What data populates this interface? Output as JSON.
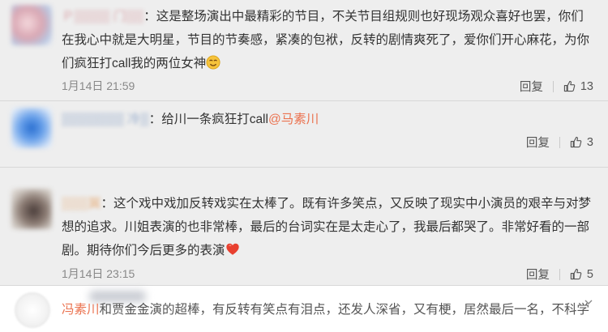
{
  "comments": [
    {
      "username": "Ｐ▒▒▒▒ 门▒▒",
      "separator": "：",
      "text": "这是整场演出中最精彩的节目，不关节目组规则也好现场观众喜好也罢，你们在我心中就是大明星，节目的节奏感，紧凑的包袱，反转的剧情爽死了，爱你们开心麻花，为你们疯狂打call我的两位女神",
      "emoji": "emoji-face-icon",
      "date": "1月14日 21:59",
      "reply_label": "回复",
      "likes": "13"
    },
    {
      "username": "▒▒▒▒▒▒▒ 冷▒",
      "separator": "：",
      "text": "给川一条疯狂打call",
      "mention": "@马素川",
      "reply_label": "回复",
      "likes": "3"
    },
    {
      "username": "▒▒▒翼",
      "separator": "：",
      "text": "这个戏中戏加反转戏实在太棒了。既有许多笑点，又反映了现实中小演员的艰辛与对梦想的追求。川姐表演的也非常棒，最后的台词实在是太走心了，我最后都哭了。非常好看的一部剧。期待你们今后更多的表演",
      "emoji": "heart-icon",
      "date": "1月14日 23:15",
      "reply_label": "回复",
      "likes": "5"
    },
    {
      "mention": "冯素川",
      "text": "和贾金金演的超棒，有反转有笑点有泪点，还发人深省，又有梗，居然最后一名，不科学"
    }
  ],
  "colors": {
    "mention": "#eb7350",
    "meta": "#888888",
    "background": "#eeeeee"
  }
}
